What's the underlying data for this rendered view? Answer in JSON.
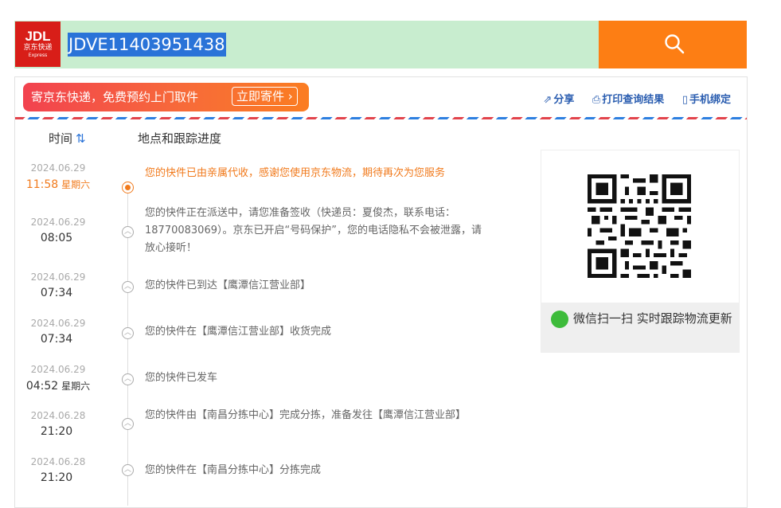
{
  "logo": {
    "brand": "JDL",
    "cn": "京东快递",
    "en": "Express"
  },
  "search": {
    "value": "JDVE11403951438"
  },
  "icons": {
    "search": "search-icon",
    "share": "share-icon",
    "print": "print-icon",
    "phone": "phone-icon",
    "wechat": "wechat-icon"
  },
  "colors": {
    "accent": "#fd7e14",
    "brand": "#d81e18",
    "active": "#f17a1c",
    "link": "#2a5db0"
  },
  "banner": {
    "text": "寄京东快递，免费预约上门取件",
    "button": "立即寄件 ›"
  },
  "tools": {
    "share": "分享",
    "print": "打印查询结果",
    "bind": "手机绑定"
  },
  "table": {
    "time_header": "时间",
    "sort_glyph": "⇅",
    "loc_header": "地点和跟踪进度"
  },
  "events": [
    {
      "date": "2024.06.29",
      "time": "11:58",
      "weekday": "星期六",
      "desc": "您的快件已由亲属代收，感谢您使用京东物流，期待再次为您服务"
    },
    {
      "date": "2024.06.29",
      "time": "08:05",
      "weekday": "",
      "desc": "您的快件正在派送中，请您准备签收（快递员：夏俊杰，联系电话：18770083069）。京东已开启“号码保护”，您的电话隐私不会被泄露，请放心接听！"
    },
    {
      "date": "2024.06.29",
      "time": "07:34",
      "weekday": "",
      "desc": "您的快件已到达【鹰潭信江营业部】"
    },
    {
      "date": "2024.06.29",
      "time": "07:34",
      "weekday": "",
      "desc": "您的快件在【鹰潭信江营业部】收货完成"
    },
    {
      "date": "2024.06.29",
      "time": "04:52",
      "weekday": "星期六",
      "desc": "您的快件已发车"
    },
    {
      "date": "2024.06.28",
      "time": "21:20",
      "weekday": "",
      "desc": "您的快件由【南昌分拣中心】完成分拣，准备发往【鹰潭信江营业部】"
    },
    {
      "date": "2024.06.28",
      "time": "21:20",
      "weekday": "",
      "desc": "您的快件在【南昌分拣中心】分拣完成"
    }
  ],
  "qr": {
    "caption": "微信扫一扫 实时跟踪物流更新"
  }
}
